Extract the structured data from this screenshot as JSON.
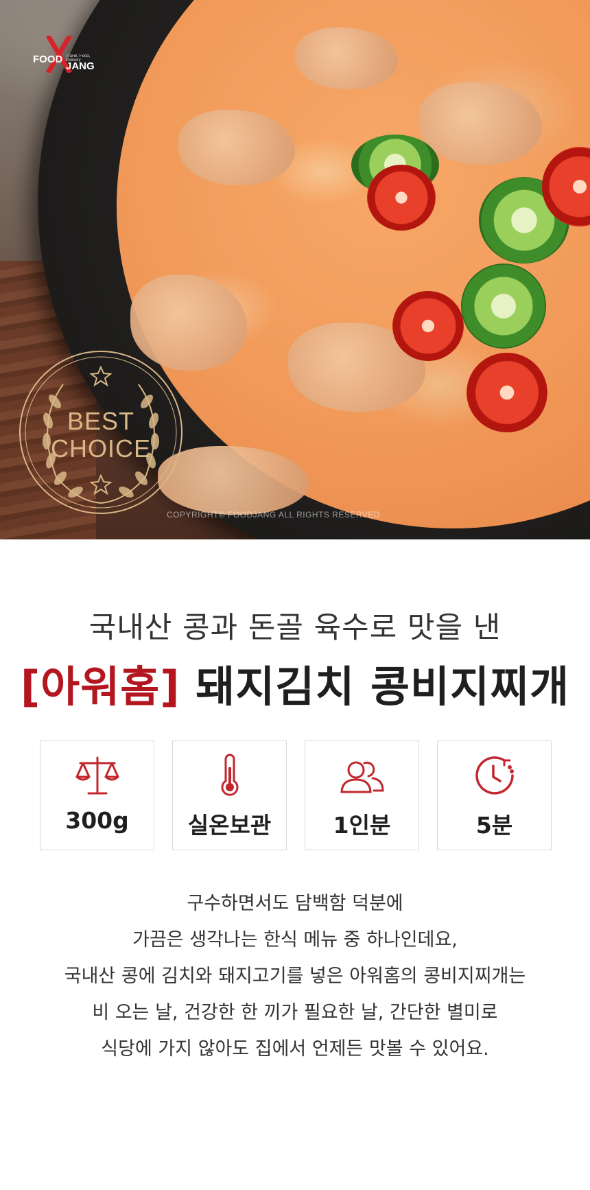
{
  "hero": {
    "logo": {
      "brand_line1": "FOOD",
      "brand_line2": "JANG",
      "tagline": "Travel, Food, Delivery"
    },
    "badge": {
      "line1": "BEST",
      "line2": "CHOICE"
    },
    "copyright": "COPYRIGHT© FOODJANG ALL RIGHTS RESERVED"
  },
  "heading": {
    "subtitle": "국내산 콩과 돈골 육수로 맛을 낸",
    "brand": "[아워홈]",
    "product": "돼지김치 콩비지찌개"
  },
  "specs": [
    {
      "icon": "scale-icon",
      "label": "300g"
    },
    {
      "icon": "thermometer-icon",
      "label": "실온보관"
    },
    {
      "icon": "people-icon",
      "label": "1인분"
    },
    {
      "icon": "clock-icon",
      "label": "5분"
    }
  ],
  "description": [
    "구수하면서도 담백함 덕분에",
    "가끔은 생각나는 한식 메뉴 중 하나인데요,",
    "국내산 콩에 김치와 돼지고기를 넣은 아워홈의 콩비지찌개는",
    "비 오는 날, 건강한 한 끼가 필요한 날, 간단한 별미로",
    "식당에 가지 않아도 집에서 언제든 맛볼 수 있어요."
  ],
  "colors": {
    "accent": "#b3161f",
    "icon": "#c1272d",
    "badge_gold": "#d9b887",
    "box_border": "#d9d9d9"
  }
}
